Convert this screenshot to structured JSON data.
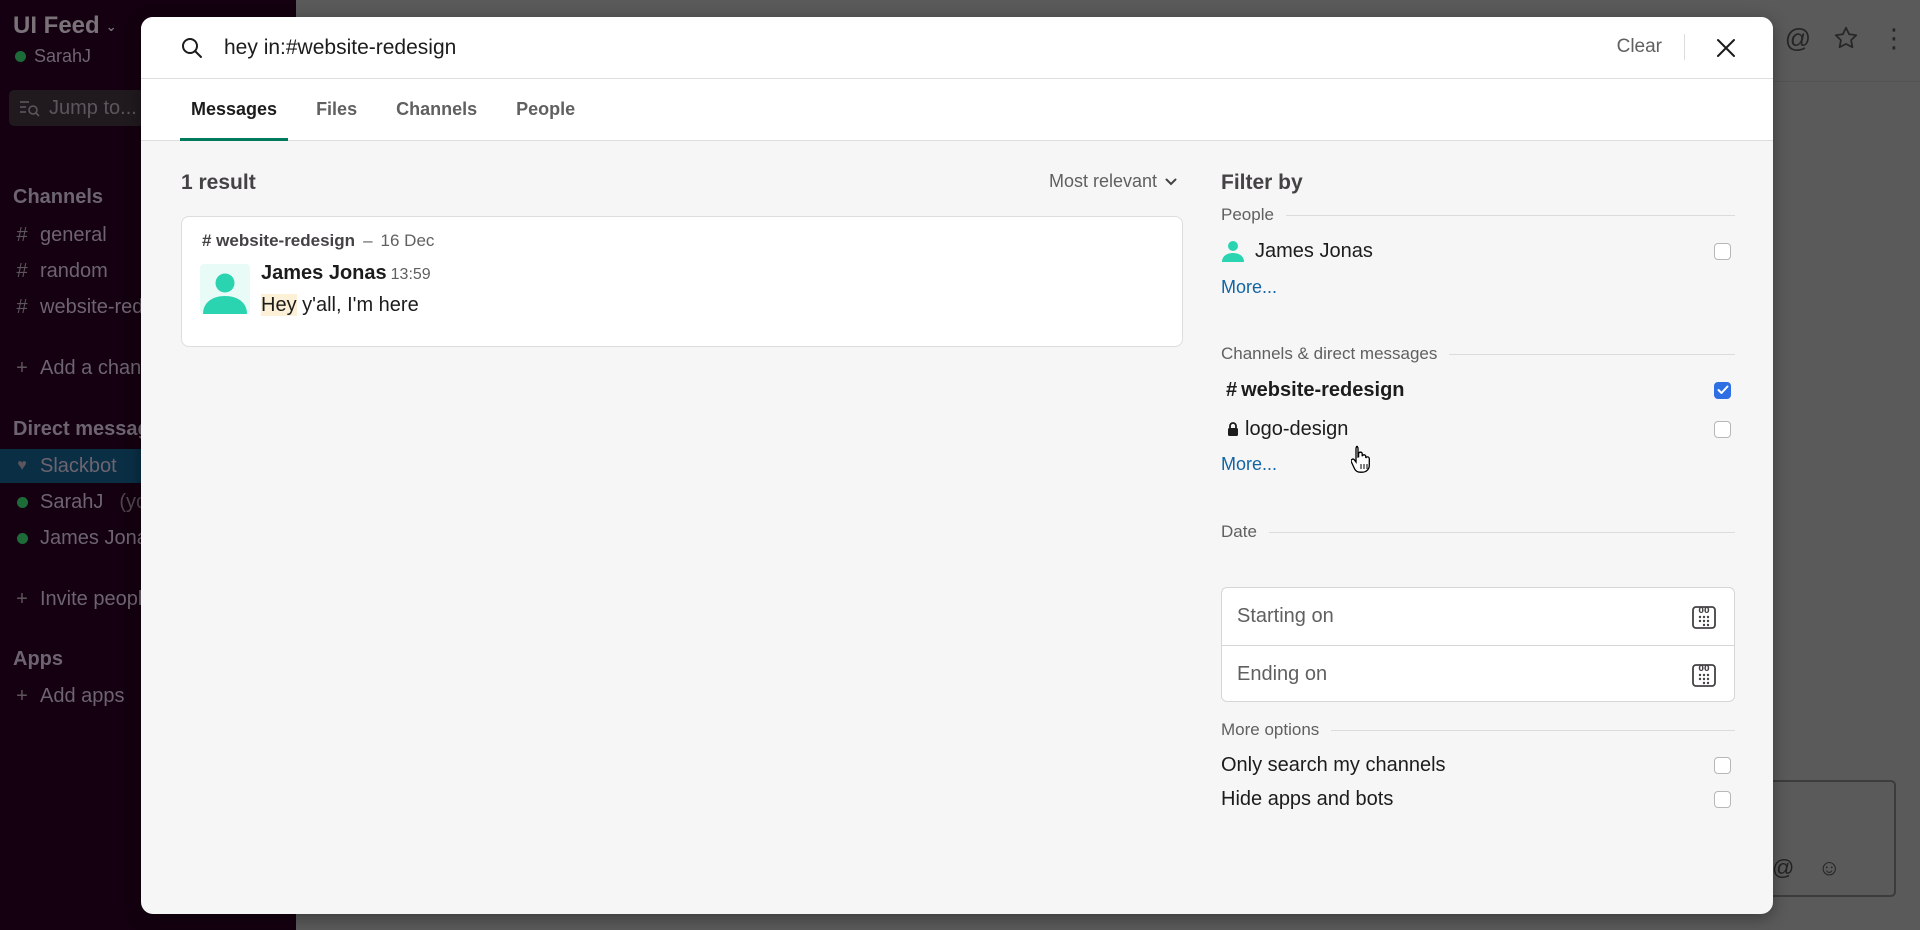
{
  "sidebar": {
    "workspace_name": "UI Feed",
    "user_name": "SarahJ",
    "jump_placeholder": "Jump to...",
    "channels_heading": "Channels",
    "channels": [
      {
        "prefix": "#",
        "name": "general"
      },
      {
        "prefix": "#",
        "name": "random"
      },
      {
        "prefix": "#",
        "name": "website-redesign"
      }
    ],
    "add_channel": "Add a channel",
    "dm_heading": "Direct messages",
    "dms": [
      {
        "name": "Slackbot",
        "suffix": "",
        "icon": "heart-icon",
        "active": true
      },
      {
        "name": "SarahJ",
        "suffix": "(you)",
        "icon": "presence-dot",
        "active": false
      },
      {
        "name": "James Jonas",
        "suffix": "",
        "icon": "presence-dot",
        "active": false
      }
    ],
    "invite": "Invite people",
    "apps_heading": "Apps",
    "add_apps": "Add apps"
  },
  "search": {
    "query": "hey in:#website-redesign",
    "clear_label": "Clear",
    "close_icon": "close-icon"
  },
  "tabs": [
    {
      "label": "Messages",
      "active": true
    },
    {
      "label": "Files",
      "active": false
    },
    {
      "label": "Channels",
      "active": false
    },
    {
      "label": "People",
      "active": false
    }
  ],
  "results": {
    "count_label": "1 result",
    "sort_label": "Most relevant",
    "items": [
      {
        "channel": "# website-redesign",
        "separator": "–",
        "date": "16 Dec",
        "author": "James Jonas",
        "time": "13:59",
        "text_highlight": "Hey",
        "text_rest": " y'all, I'm here"
      }
    ]
  },
  "filters": {
    "title": "Filter by",
    "people_heading": "People",
    "people": [
      {
        "name": "James Jonas",
        "checked": false
      }
    ],
    "people_more": "More...",
    "channels_heading": "Channels & direct messages",
    "channels": [
      {
        "prefix": "#",
        "name": "website-redesign",
        "checked": true,
        "private": false
      },
      {
        "prefix": "lock",
        "name": "logo-design",
        "checked": false,
        "private": true
      }
    ],
    "channels_more": "More...",
    "date_heading": "Date",
    "date_start_placeholder": "Starting on",
    "date_end_placeholder": "Ending on",
    "more_options_heading": "More options",
    "options": [
      {
        "label": "Only search my channels",
        "checked": false
      },
      {
        "label": "Hide apps and bots",
        "checked": false
      }
    ]
  },
  "colors": {
    "accent_tab": "#007a5a",
    "link": "#1264a3",
    "checkbox_checked": "#2f6fe4",
    "avatar": "#2bd4b0",
    "highlight": "#fcf1d6",
    "sidebar_bg": "#140010"
  }
}
